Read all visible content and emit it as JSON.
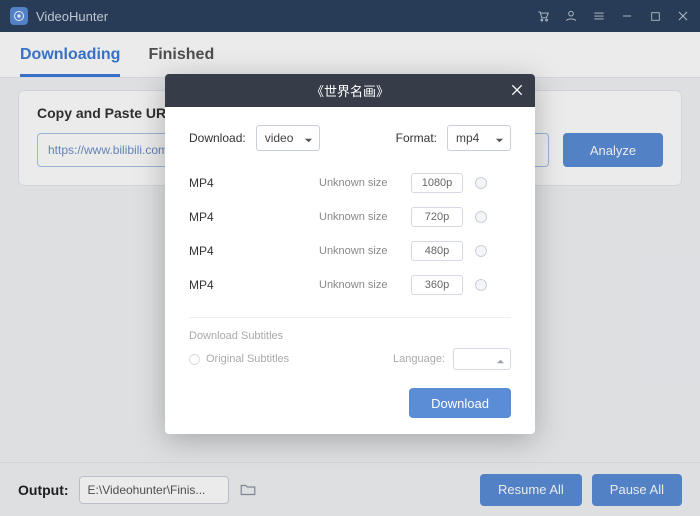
{
  "app": {
    "title": "VideoHunter"
  },
  "tabs": {
    "items": [
      "Downloading",
      "Finished"
    ],
    "active": 0
  },
  "urlPanel": {
    "title": "Copy and Paste URL",
    "inputValue": "https://www.bilibili.com/v",
    "analyze": "Analyze"
  },
  "footer": {
    "outputLabel": "Output:",
    "outputPath": "E:\\Videohunter\\Finis...",
    "resume": "Resume All",
    "pause": "Pause All"
  },
  "dialog": {
    "title": "《世界名画》",
    "downloadLabel": "Download:",
    "downloadValue": "video",
    "formatLabel": "Format:",
    "formatValue": "mp4",
    "rows": [
      {
        "fmt": "MP4",
        "size": "Unknown size",
        "res": "1080p"
      },
      {
        "fmt": "MP4",
        "size": "Unknown size",
        "res": "720p"
      },
      {
        "fmt": "MP4",
        "size": "Unknown size",
        "res": "480p"
      },
      {
        "fmt": "MP4",
        "size": "Unknown size",
        "res": "360p"
      }
    ],
    "subTitle": "Download Subtitles",
    "origSubs": "Original Subtitles",
    "langLabel": "Language:",
    "downloadBtn": "Download"
  }
}
